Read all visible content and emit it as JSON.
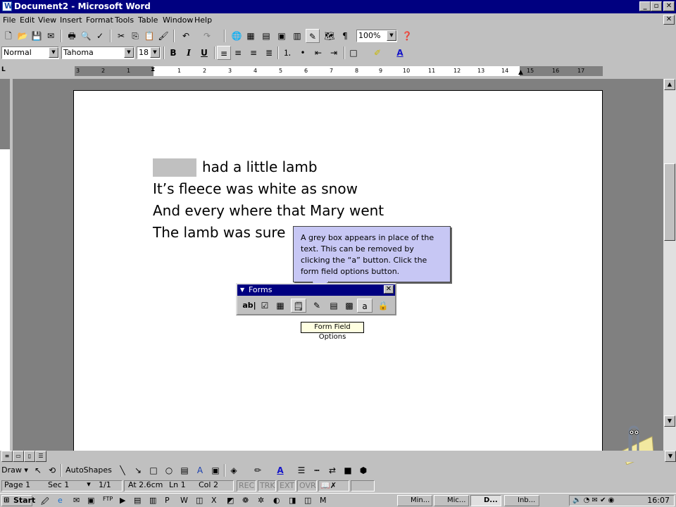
{
  "window": {
    "title": "Document2 - Microsoft Word"
  },
  "menu": [
    "File",
    "Edit",
    "View",
    "Insert",
    "Format",
    "Tools",
    "Table",
    "Window",
    "Help"
  ],
  "standard_toolbar": {
    "zoom": "100%"
  },
  "format_toolbar": {
    "style": "Normal",
    "font": "Tahoma",
    "size": "18"
  },
  "ruler": {
    "ticks": [
      "3",
      "2",
      "1",
      "1",
      "2",
      "3",
      "4",
      "5",
      "6",
      "7",
      "8",
      "9",
      "10",
      "11",
      "12",
      "13",
      "14",
      "15",
      "16",
      "17"
    ]
  },
  "document": {
    "lines": [
      "had a little lamb",
      "It’s fleece was white as snow",
      "And every where that Mary went",
      "The lamb was sure"
    ]
  },
  "forms_toolbar": {
    "title": "Forms"
  },
  "callout": {
    "text": "A grey box appears in place of the text.  This can be removed by clicking the “a” button.  Click the form field options button."
  },
  "tooltip": {
    "text": "Form Field Options"
  },
  "drawing_toolbar": {
    "draw": "Draw",
    "autoshapes": "AutoShapes"
  },
  "status": {
    "page": "Page 1",
    "sec": "Sec 1",
    "pages": "1/1",
    "at": "At 2.6cm",
    "ln": "Ln 1",
    "col": "Col 2",
    "rec": "REC",
    "trk": "TRK",
    "ext": "EXT",
    "ovr": "OVR"
  },
  "taskbar": {
    "start": "Start",
    "tasks": [
      "Min...",
      "Mic...",
      "D...",
      "Inb..."
    ],
    "clock": "16:07"
  }
}
